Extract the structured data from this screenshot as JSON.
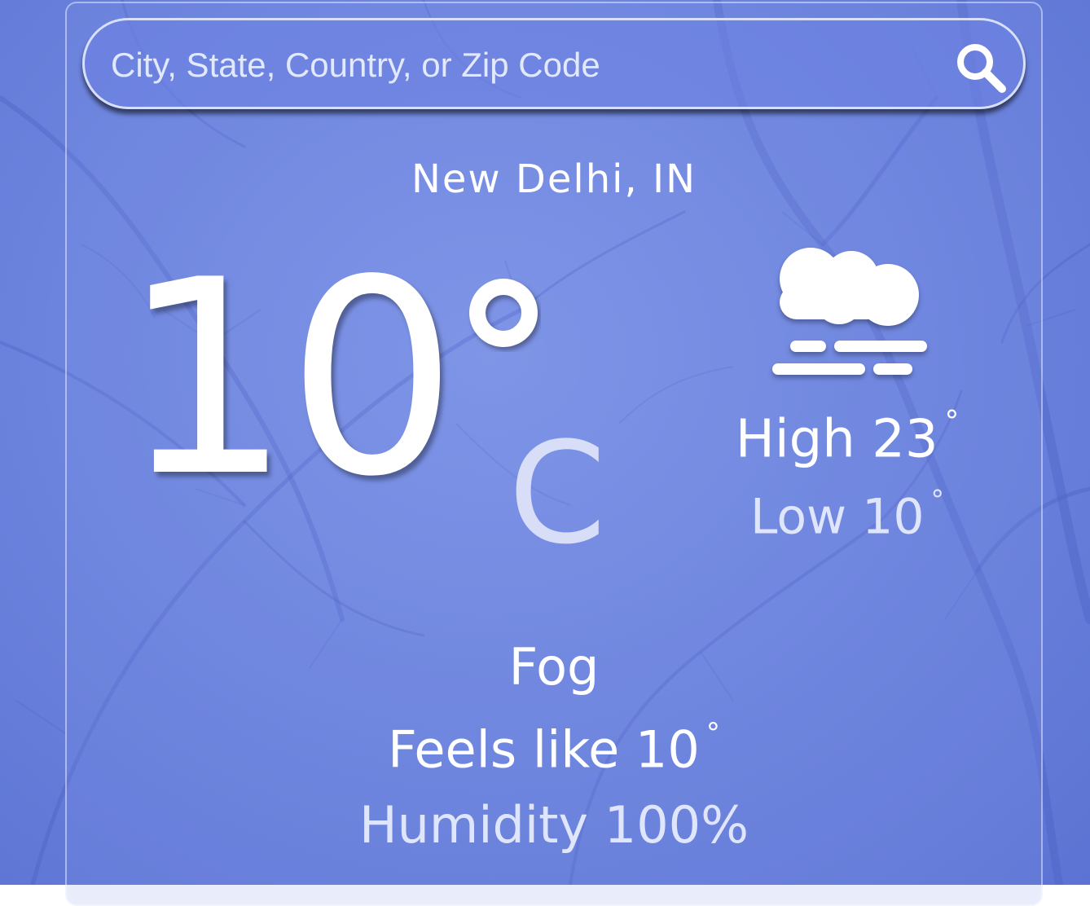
{
  "search": {
    "placeholder": "City, State, Country, or Zip Code",
    "value": ""
  },
  "location": {
    "name": "New Delhi, IN"
  },
  "current": {
    "temperature": "10",
    "unit": "C",
    "condition": "Fog",
    "feels_like": "Feels like 10",
    "humidity": "Humidity 100%"
  },
  "forecast": {
    "high": "High 23",
    "low": "Low 10"
  },
  "icons": {
    "search": "search-icon",
    "weather": "fog-icon",
    "degree": "degree-icon"
  },
  "colors": {
    "background": "#6f86df",
    "text_primary": "#ffffff",
    "text_secondary": "#dfe5fb"
  }
}
